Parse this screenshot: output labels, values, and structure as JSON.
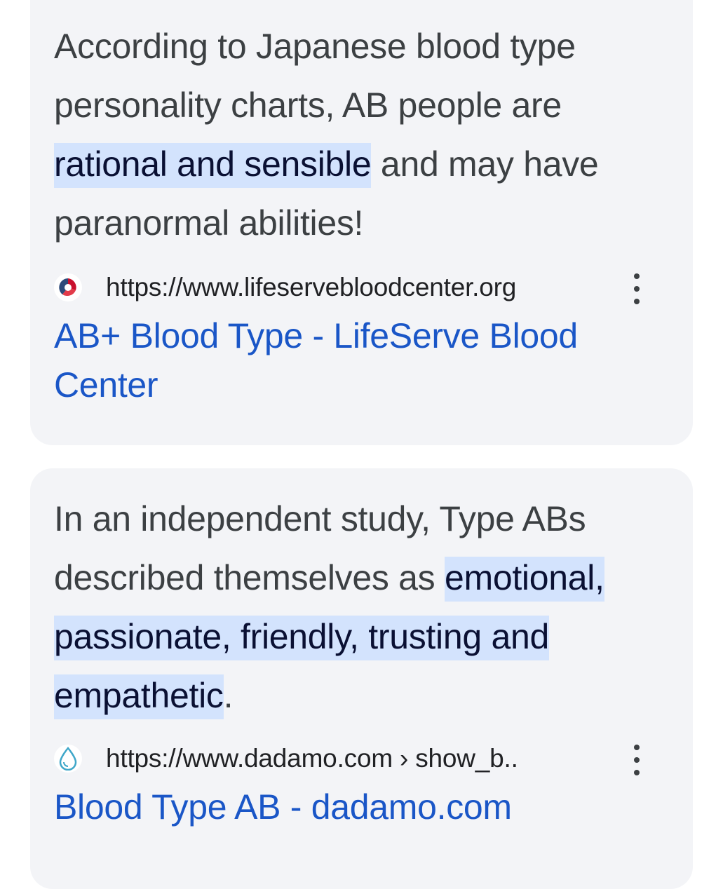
{
  "results": [
    {
      "snippet_before": "According to Japanese blood type personality charts, AB people are ",
      "snippet_highlight": "rational and sensible",
      "snippet_after": " and may have paranormal abilities!",
      "url": "https://www.lifeservebloodcenter.org",
      "title": "AB+ Blood Type - LifeServe Blood Center",
      "favicon": "lifeserve-logo-icon"
    },
    {
      "snippet_before": "In an independent study, Type ABs described themselves as ",
      "snippet_highlight": "emotional, passionate, friendly, trusting and empathetic",
      "snippet_after": ".",
      "url": "https://www.dadamo.com › show_b..",
      "title": "Blood Type AB - dadamo.com",
      "favicon": "water-drop-icon"
    }
  ],
  "colors": {
    "card_bg": "#f3f4f7",
    "highlight_bg": "#d3e3fd",
    "link": "#1a56c7",
    "text": "#3c4043"
  }
}
